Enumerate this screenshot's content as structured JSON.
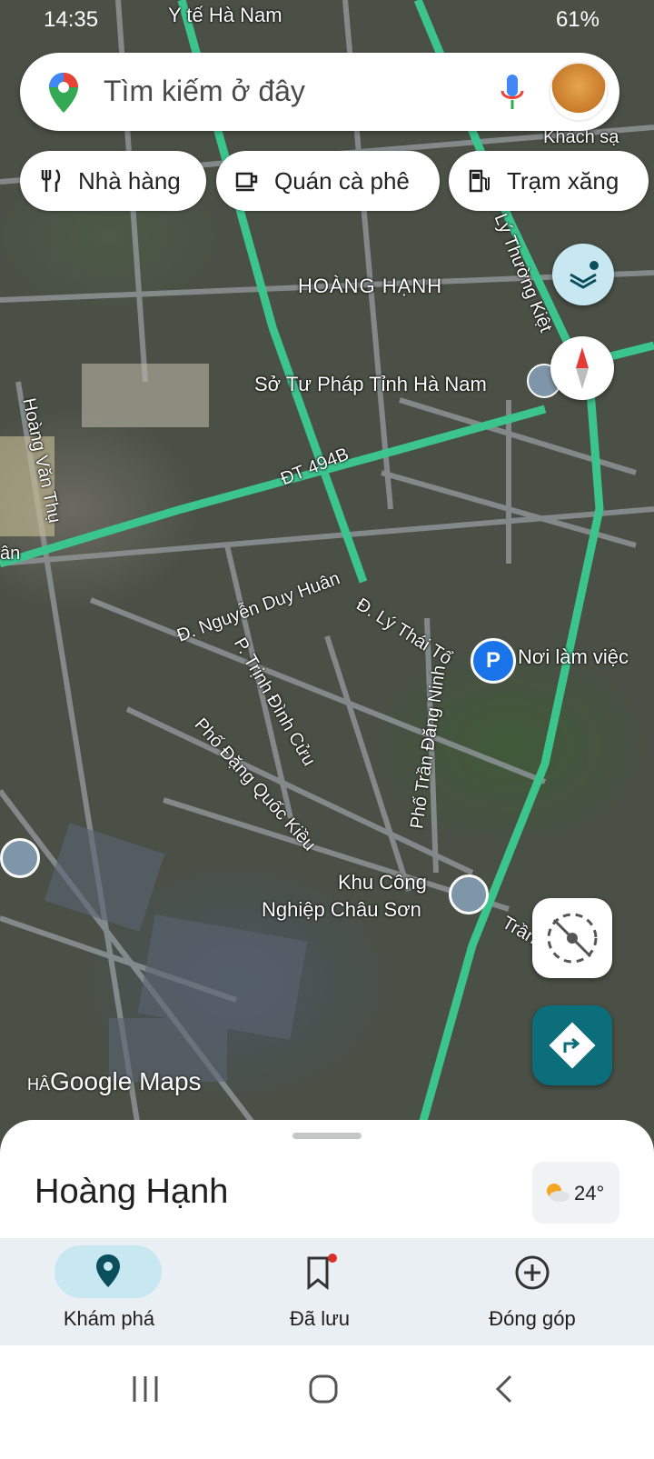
{
  "status_bar": {
    "time": "14:35",
    "battery": "61%"
  },
  "search": {
    "placeholder": "Tìm kiếm ở đây"
  },
  "chips": [
    {
      "label": "Nhà hàng",
      "icon": "restaurant-icon"
    },
    {
      "label": "Quán cà phê",
      "icon": "coffee-icon"
    },
    {
      "label": "Trạm xăng",
      "icon": "gas-station-icon"
    }
  ],
  "map": {
    "top_labels": [
      "Y tế Hà Nam",
      "Khách sạ"
    ],
    "area_label": "HOÀNG HẠNH",
    "poi_labels": [
      "Sở Tư Pháp Tỉnh Hà Nam",
      "Nơi làm việc",
      "Khu Công",
      "Nghiệp Châu Sơn"
    ],
    "streets": [
      "Lý Thường Kiệt",
      "ĐT 494B",
      "Hoàng Văn Thụ",
      "Đ. Nguyễn Duy Huân",
      "P. Trịnh Đình Cửu",
      "Phố Đặng Quốc Kiều",
      "Đ. Lý Thái Tổ",
      "Phố Trần Đăng Ninh",
      "Trần",
      "ân"
    ],
    "watermark": "Google Maps",
    "watermark_prefix": "HÂ"
  },
  "sheet": {
    "title": "Hoàng Hạnh",
    "temperature": "24°"
  },
  "bottom_nav": [
    {
      "label": "Khám phá",
      "icon": "explore-pin-icon",
      "active": true
    },
    {
      "label": "Đã lưu",
      "icon": "bookmark-icon",
      "active": false
    },
    {
      "label": "Đóng góp",
      "icon": "add-circle-icon",
      "active": false
    }
  ],
  "colors": {
    "road": "#9aa0a6",
    "highway": "#34c08a",
    "accent": "#0b6e7a",
    "nav_bg": "#e9eff3",
    "active_pill": "#c7e8f0"
  }
}
